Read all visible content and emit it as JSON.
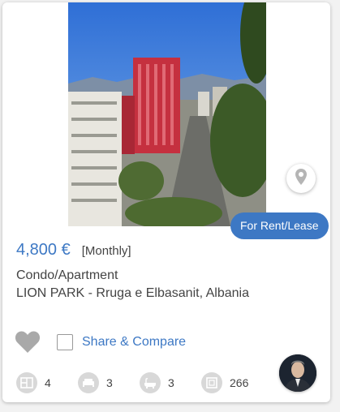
{
  "listing": {
    "price": "4,800 €",
    "period": "[Monthly]",
    "property_type": "Condo/Apartment",
    "address": "LION PARK - Rruga e Elbasanit, Albania",
    "status": "For Rent/Lease",
    "compare_label": "Share & Compare"
  },
  "amenities": [
    {
      "icon": "rooms-icon",
      "value": "4"
    },
    {
      "icon": "bed-icon",
      "value": "3"
    },
    {
      "icon": "bath-icon",
      "value": "3"
    },
    {
      "icon": "area-icon",
      "value": "266"
    }
  ],
  "colors": {
    "accent": "#3d78c4",
    "icon_gray": "#d8d8d8",
    "heart_gray": "#a9a9a9"
  }
}
